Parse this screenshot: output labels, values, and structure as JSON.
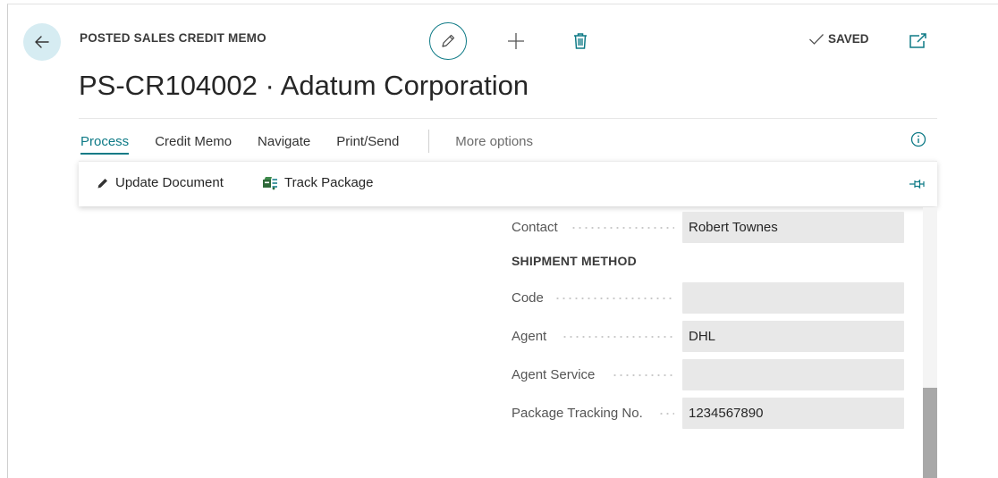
{
  "header": {
    "caption": "POSTED SALES CREDIT MEMO",
    "title": "PS-CR104002 · Adatum Corporation",
    "status": "SAVED"
  },
  "icons": {
    "back": "arrow-left-icon",
    "edit": "pencil-icon",
    "add": "plus-icon",
    "delete": "trash-icon",
    "saved": "checkmark-icon",
    "popout": "popout-icon",
    "info": "info-icon",
    "pin": "pin-icon",
    "update": "pencil-small-icon",
    "track": "track-package-icon"
  },
  "menu": {
    "items": [
      {
        "label": "Process",
        "active": true
      },
      {
        "label": "Credit Memo"
      },
      {
        "label": "Navigate"
      },
      {
        "label": "Print/Send"
      }
    ],
    "more": "More options"
  },
  "actions": {
    "update_document": "Update Document",
    "track_package": "Track Package"
  },
  "fields": {
    "contact": {
      "label": "Contact",
      "value": "Robert Townes"
    },
    "section": "SHIPMENT METHOD",
    "code": {
      "label": "Code",
      "value": ""
    },
    "agent": {
      "label": "Agent",
      "value": "DHL"
    },
    "agent_service": {
      "label": "Agent Service",
      "value": ""
    },
    "tracking_no": {
      "label": "Package Tracking No.",
      "value": "1234567890"
    }
  },
  "colors": {
    "accent": "#0e7a86",
    "back_bg": "#d6ecf2",
    "field_bg": "#e8e8e8"
  }
}
